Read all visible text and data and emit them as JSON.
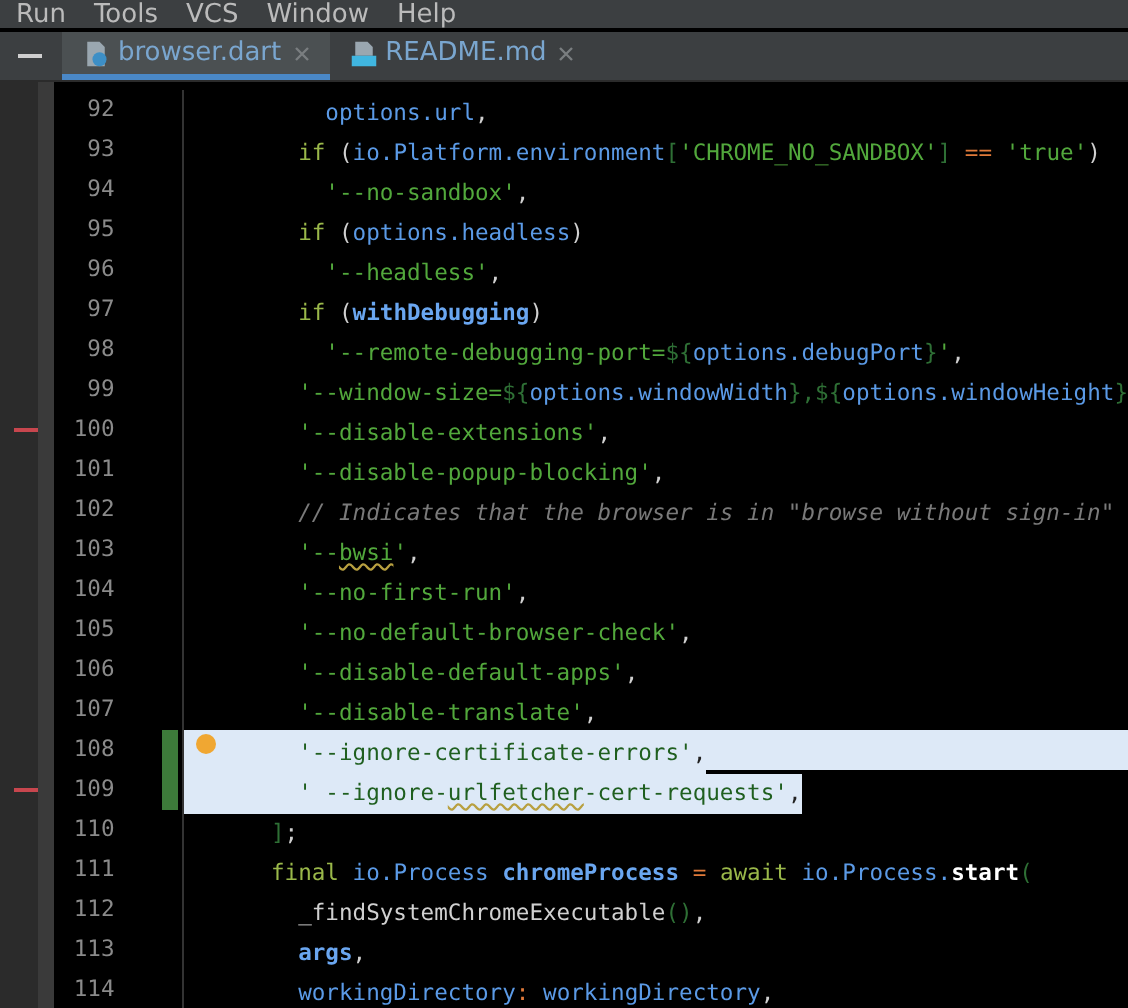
{
  "menu": [
    "Run",
    "Tools",
    "VCS",
    "Window",
    "Help"
  ],
  "tabs": [
    {
      "label": "browser.dart",
      "kind": "dart",
      "selected": true
    },
    {
      "label": "README.md",
      "kind": "md",
      "selected": false
    }
  ],
  "lines": [
    {
      "n": "92",
      "selected": false,
      "marker": false,
      "changed": false,
      "bulb": false,
      "code": [
        {
          "t": "        options.url",
          "kind": "id"
        },
        {
          "t": ",",
          "kind": "p"
        }
      ]
    },
    {
      "n": "93",
      "selected": false,
      "marker": false,
      "changed": false,
      "bulb": false,
      "code": [
        {
          "t": "      if",
          "kind": "kw"
        },
        {
          "t": " (",
          "kind": "p"
        },
        {
          "t": "io.Platform.environment",
          "kind": "id"
        },
        {
          "t": "[",
          "kind": "br"
        },
        {
          "t": "'CHROME_NO_SANDBOX'",
          "kind": "str"
        },
        {
          "t": "]",
          "kind": "br"
        },
        {
          "t": " == ",
          "kind": "op"
        },
        {
          "t": "'true'",
          "kind": "str"
        },
        {
          "t": ")",
          "kind": "p"
        }
      ]
    },
    {
      "n": "94",
      "selected": false,
      "marker": false,
      "changed": false,
      "bulb": false,
      "code": [
        {
          "t": "        '--no-sandbox'",
          "kind": "str"
        },
        {
          "t": ",",
          "kind": "p"
        }
      ]
    },
    {
      "n": "95",
      "selected": false,
      "marker": false,
      "changed": false,
      "bulb": false,
      "code": [
        {
          "t": "      if",
          "kind": "kw"
        },
        {
          "t": " (",
          "kind": "p"
        },
        {
          "t": "options.headless",
          "kind": "id"
        },
        {
          "t": ")",
          "kind": "p"
        }
      ]
    },
    {
      "n": "96",
      "selected": false,
      "marker": false,
      "changed": false,
      "bulb": false,
      "code": [
        {
          "t": "        '--headless'",
          "kind": "str"
        },
        {
          "t": ",",
          "kind": "p"
        }
      ]
    },
    {
      "n": "97",
      "selected": false,
      "marker": false,
      "changed": false,
      "bulb": false,
      "code": [
        {
          "t": "      if",
          "kind": "kw"
        },
        {
          "t": " (",
          "kind": "p"
        },
        {
          "t": "withDebugging",
          "kind": "bid"
        },
        {
          "t": ")",
          "kind": "p"
        }
      ]
    },
    {
      "n": "98",
      "selected": false,
      "marker": false,
      "changed": false,
      "bulb": false,
      "code": [
        {
          "t": "        '--remote-debugging-port=",
          "kind": "str"
        },
        {
          "t": "${",
          "kind": "br"
        },
        {
          "t": "options.debugPort",
          "kind": "id"
        },
        {
          "t": "}",
          "kind": "br"
        },
        {
          "t": "'",
          "kind": "str"
        },
        {
          "t": ",",
          "kind": "p"
        }
      ]
    },
    {
      "n": "99",
      "selected": false,
      "marker": false,
      "changed": false,
      "bulb": false,
      "code": [
        {
          "t": "      '--window-size=",
          "kind": "str"
        },
        {
          "t": "${",
          "kind": "br"
        },
        {
          "t": "options.windowWidth",
          "kind": "id"
        },
        {
          "t": "}",
          "kind": "br"
        },
        {
          "t": ",${",
          "kind": "br"
        },
        {
          "t": "options.windowHeight",
          "kind": "id"
        },
        {
          "t": "}",
          "kind": "br"
        }
      ]
    },
    {
      "n": "100",
      "selected": false,
      "marker": true,
      "changed": false,
      "bulb": false,
      "code": [
        {
          "t": "      '--disable-extensions'",
          "kind": "str"
        },
        {
          "t": ",",
          "kind": "p"
        }
      ]
    },
    {
      "n": "101",
      "selected": false,
      "marker": false,
      "changed": false,
      "bulb": false,
      "code": [
        {
          "t": "      '--disable-popup-blocking'",
          "kind": "str"
        },
        {
          "t": ",",
          "kind": "p"
        }
      ]
    },
    {
      "n": "102",
      "selected": false,
      "marker": false,
      "changed": false,
      "bulb": false,
      "code": [
        {
          "t": "      // Indicates that the browser is in \"browse without sign-in\"",
          "kind": "cm"
        }
      ]
    },
    {
      "n": "103",
      "selected": false,
      "marker": false,
      "changed": false,
      "bulb": false,
      "code": [
        {
          "t": "      '--",
          "kind": "str"
        },
        {
          "t": "bwsi",
          "kind": "warn"
        },
        {
          "t": "'",
          "kind": "str"
        },
        {
          "t": ",",
          "kind": "p"
        }
      ]
    },
    {
      "n": "104",
      "selected": false,
      "marker": false,
      "changed": false,
      "bulb": false,
      "code": [
        {
          "t": "      '--no-first-run'",
          "kind": "str"
        },
        {
          "t": ",",
          "kind": "p"
        }
      ]
    },
    {
      "n": "105",
      "selected": false,
      "marker": false,
      "changed": false,
      "bulb": false,
      "code": [
        {
          "t": "      '--no-default-browser-check'",
          "kind": "str"
        },
        {
          "t": ",",
          "kind": "p"
        }
      ]
    },
    {
      "n": "106",
      "selected": false,
      "marker": false,
      "changed": false,
      "bulb": false,
      "code": [
        {
          "t": "      '--disable-default-apps'",
          "kind": "str"
        },
        {
          "t": ",",
          "kind": "p"
        }
      ]
    },
    {
      "n": "107",
      "selected": false,
      "marker": false,
      "changed": false,
      "bulb": false,
      "code": [
        {
          "t": "      '--disable-translate'",
          "kind": "str"
        },
        {
          "t": ",",
          "kind": "p"
        }
      ]
    },
    {
      "n": "108",
      "selected": true,
      "marker": false,
      "changed": true,
      "bulb": true,
      "code": [
        {
          "t": "      '--ignore-certificate-errors'",
          "kind": "str"
        },
        {
          "t": ",",
          "kind": "p"
        }
      ]
    },
    {
      "n": "109",
      "selected": true,
      "marker": true,
      "changed": true,
      "bulb": false,
      "code": [
        {
          "t": "      ' --ignore-",
          "kind": "str"
        },
        {
          "t": "urlfetcher",
          "kind": "warn"
        },
        {
          "t": "-cert-requests'",
          "kind": "str"
        },
        {
          "t": ",",
          "kind": "p"
        }
      ]
    },
    {
      "n": "110",
      "selected": false,
      "marker": false,
      "changed": false,
      "bulb": false,
      "code": [
        {
          "t": "    ]",
          "kind": "br"
        },
        {
          "t": ";",
          "kind": "p"
        }
      ]
    },
    {
      "n": "111",
      "selected": false,
      "marker": false,
      "changed": false,
      "bulb": false,
      "code": [
        {
          "t": "    final",
          "kind": "kw"
        },
        {
          "t": " io.Process ",
          "kind": "id"
        },
        {
          "t": "chromeProcess",
          "kind": "bid"
        },
        {
          "t": " = ",
          "kind": "op"
        },
        {
          "t": "await",
          "kind": "kw"
        },
        {
          "t": " io.Process.",
          "kind": "id"
        },
        {
          "t": "start",
          "kind": "fn"
        },
        {
          "t": "(",
          "kind": "br"
        }
      ]
    },
    {
      "n": "112",
      "selected": false,
      "marker": false,
      "changed": false,
      "bulb": false,
      "code": [
        {
          "t": "      _findSystemChromeExecutable",
          "kind": "p"
        },
        {
          "t": "()",
          "kind": "br"
        },
        {
          "t": ",",
          "kind": "p"
        }
      ]
    },
    {
      "n": "113",
      "selected": false,
      "marker": false,
      "changed": false,
      "bulb": false,
      "code": [
        {
          "t": "      args",
          "kind": "bid"
        },
        {
          "t": ",",
          "kind": "p"
        }
      ]
    },
    {
      "n": "114",
      "selected": false,
      "marker": false,
      "changed": false,
      "bulb": false,
      "code": [
        {
          "t": "      workingDirectory",
          "kind": "id"
        },
        {
          "t": ": ",
          "kind": "op"
        },
        {
          "t": "workingDirectory",
          "kind": "id"
        },
        {
          "t": ",",
          "kind": "p"
        }
      ]
    }
  ]
}
